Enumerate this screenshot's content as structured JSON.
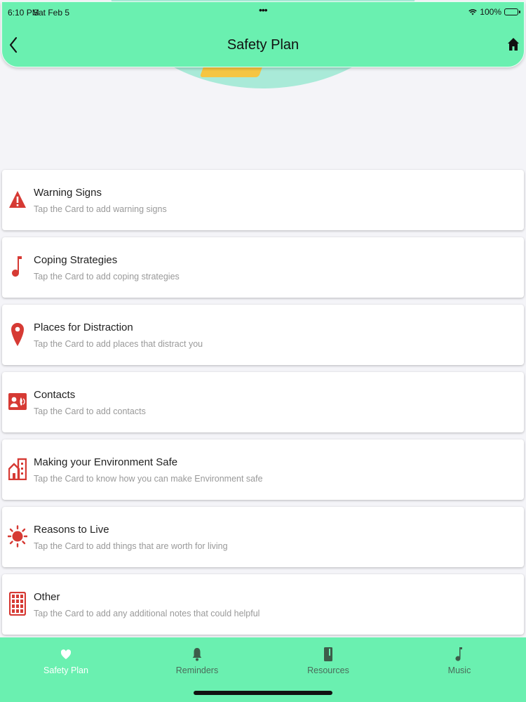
{
  "status": {
    "time": "6:10 PM",
    "date": "Sat Feb 5",
    "battery": "100%"
  },
  "header": {
    "title": "Safety Plan",
    "back_icon": "chevron-left-icon",
    "home_icon": "home-icon"
  },
  "cards": [
    {
      "title": "Warning Signs",
      "subtitle": "Tap the Card to add warning signs",
      "icon": "warning-icon"
    },
    {
      "title": "Coping Strategies",
      "subtitle": "Tap the Card to add coping strategies",
      "icon": "music-note-icon"
    },
    {
      "title": "Places for Distraction",
      "subtitle": "Tap the Card to add places that distract you",
      "icon": "location-pin-icon"
    },
    {
      "title": "Contacts",
      "subtitle": "Tap the Card to add contacts",
      "icon": "contact-card-icon"
    },
    {
      "title": "Making your Environment Safe",
      "subtitle": "Tap the Card to know how you can make Environment safe",
      "icon": "home-building-icon"
    },
    {
      "title": "Reasons to Live",
      "subtitle": "Tap the Card to add things that are worth for living",
      "icon": "sun-icon"
    },
    {
      "title": "Other",
      "subtitle": "Tap the Card to add any additional notes that could helpful",
      "icon": "grid-icon"
    }
  ],
  "tabs": [
    {
      "label": "Safety Plan",
      "icon": "heart-icon",
      "active": true
    },
    {
      "label": "Reminders",
      "icon": "bell-icon",
      "active": false
    },
    {
      "label": "Resources",
      "icon": "book-icon",
      "active": false
    },
    {
      "label": "Music",
      "icon": "music-note-icon",
      "active": false
    }
  ],
  "colors": {
    "accent": "#6af0b0",
    "icon_red": "#d63a34",
    "hero_blob": "#a9ead8",
    "hero_accent": "#f5c542"
  }
}
